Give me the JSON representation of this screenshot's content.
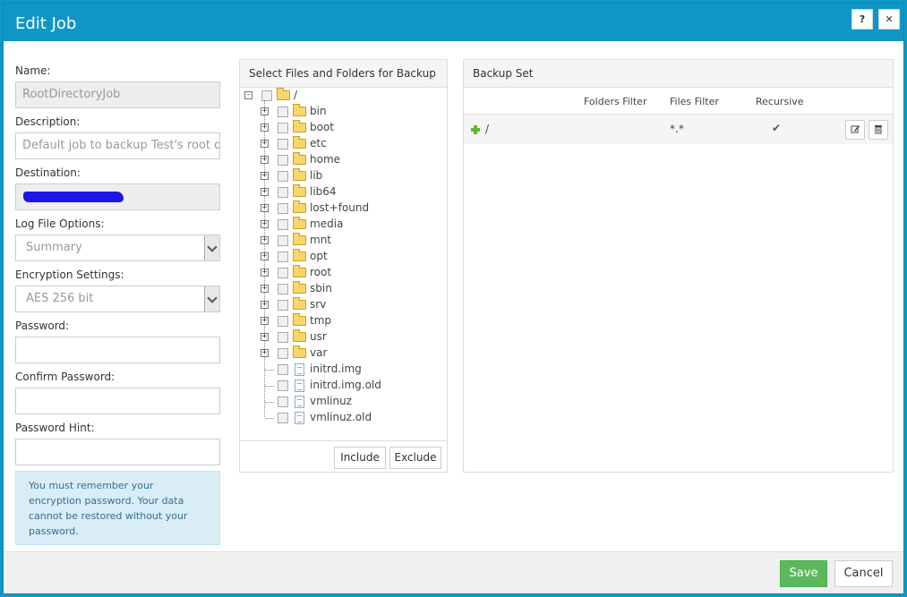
{
  "dialog": {
    "title": "Edit Job",
    "help_label": "?",
    "close_label": "✕"
  },
  "form": {
    "name_label": "Name:",
    "name_value": "RootDirectoryJob",
    "description_label": "Description:",
    "description_placeholder": "Default job to backup Test's root dir",
    "destination_label": "Destination:",
    "log_label": "Log File Options:",
    "log_value": "Summary",
    "encryption_label": "Encryption Settings:",
    "encryption_value": "AES 256 bit",
    "password_label": "Password:",
    "confirm_label": "Confirm Password:",
    "hint_label": "Password Hint:",
    "note": "You must remember your encryption password. Your data cannot be restored without your password."
  },
  "files_panel": {
    "title": "Select Files and Folders for Backup",
    "root": "/",
    "nodes": [
      {
        "label": "bin",
        "type": "folder"
      },
      {
        "label": "boot",
        "type": "folder"
      },
      {
        "label": "etc",
        "type": "folder"
      },
      {
        "label": "home",
        "type": "folder"
      },
      {
        "label": "lib",
        "type": "folder"
      },
      {
        "label": "lib64",
        "type": "folder"
      },
      {
        "label": "lost+found",
        "type": "folder"
      },
      {
        "label": "media",
        "type": "folder"
      },
      {
        "label": "mnt",
        "type": "folder"
      },
      {
        "label": "opt",
        "type": "folder"
      },
      {
        "label": "root",
        "type": "folder"
      },
      {
        "label": "sbin",
        "type": "folder"
      },
      {
        "label": "srv",
        "type": "folder"
      },
      {
        "label": "tmp",
        "type": "folder"
      },
      {
        "label": "usr",
        "type": "folder"
      },
      {
        "label": "var",
        "type": "folder"
      },
      {
        "label": "initrd.img",
        "type": "file"
      },
      {
        "label": "initrd.img.old",
        "type": "file"
      },
      {
        "label": "vmlinuz",
        "type": "file"
      },
      {
        "label": "vmlinuz.old",
        "type": "file"
      }
    ],
    "include_label": "Include",
    "exclude_label": "Exclude"
  },
  "backup_set": {
    "title": "Backup Set",
    "columns": {
      "folders_filter": "Folders Filter",
      "files_filter": "Files Filter",
      "recursive": "Recursive"
    },
    "rows": [
      {
        "path": "/",
        "folders_filter": "",
        "files_filter": "*.*",
        "recursive": "✔"
      }
    ]
  },
  "footer": {
    "save_label": "Save",
    "cancel_label": "Cancel"
  },
  "colors": {
    "titlebar": "#0f97c6",
    "save": "#5cb85c",
    "note_bg": "#d9edf7"
  }
}
